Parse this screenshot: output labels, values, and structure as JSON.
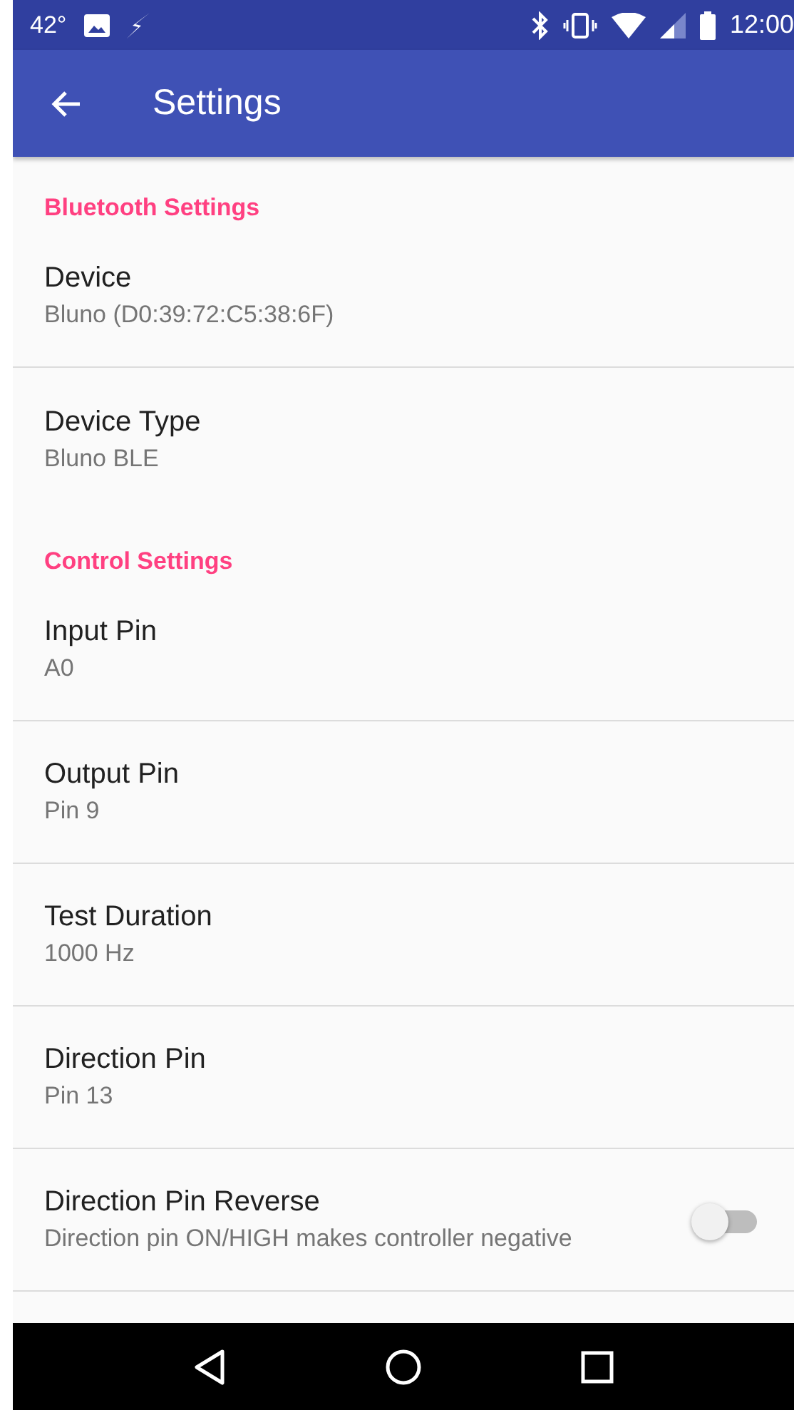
{
  "status_bar": {
    "temperature": "42°",
    "time": "12:00"
  },
  "app_bar": {
    "title": "Settings"
  },
  "sections": [
    {
      "title": "Bluetooth Settings",
      "items": [
        {
          "kind": "text",
          "title": "Device",
          "summary": "Bluno (D0:39:72:C5:38:6F)"
        },
        {
          "kind": "text",
          "title": "Device Type",
          "summary": "Bluno BLE"
        }
      ]
    },
    {
      "title": "Control Settings",
      "items": [
        {
          "kind": "text",
          "title": "Input Pin",
          "summary": "A0"
        },
        {
          "kind": "text",
          "title": "Output Pin",
          "summary": "Pin 9"
        },
        {
          "kind": "text",
          "title": "Test Duration",
          "summary": "1000 Hz"
        },
        {
          "kind": "text",
          "title": "Direction Pin",
          "summary": "Pin 13"
        },
        {
          "kind": "switch",
          "title": "Direction Pin Reverse",
          "summary": "Direction pin ON/HIGH makes controller negative",
          "on": false
        }
      ]
    }
  ]
}
